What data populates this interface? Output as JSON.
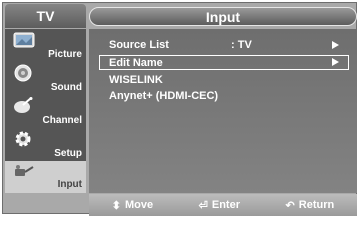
{
  "sidebar": {
    "header": "TV",
    "items": [
      {
        "label": "Picture",
        "icon": "picture-icon"
      },
      {
        "label": "Sound",
        "icon": "sound-icon"
      },
      {
        "label": "Channel",
        "icon": "channel-icon"
      },
      {
        "label": "Setup",
        "icon": "setup-icon"
      },
      {
        "label": "Input",
        "icon": "input-icon",
        "active": true
      }
    ]
  },
  "menu": {
    "title": "Input",
    "items": [
      {
        "label": "Source List",
        "value": ": TV",
        "has_arrow": true
      },
      {
        "label": "Edit Name",
        "value": "",
        "has_arrow": true,
        "selected": true
      },
      {
        "label": "WISELINK",
        "value": "",
        "has_arrow": false
      },
      {
        "label": "Anynet+ (HDMI-CEC)",
        "value": "",
        "has_arrow": false
      }
    ]
  },
  "footer": {
    "move": {
      "icon": "⬍",
      "label": "Move"
    },
    "enter": {
      "icon": "⏎",
      "label": "Enter"
    },
    "return": {
      "icon": "↶",
      "label": "Return"
    }
  },
  "colors": {
    "sidebar_bg": "#555555",
    "active_bg": "#cfcfcf",
    "content_bg": "#777777"
  }
}
